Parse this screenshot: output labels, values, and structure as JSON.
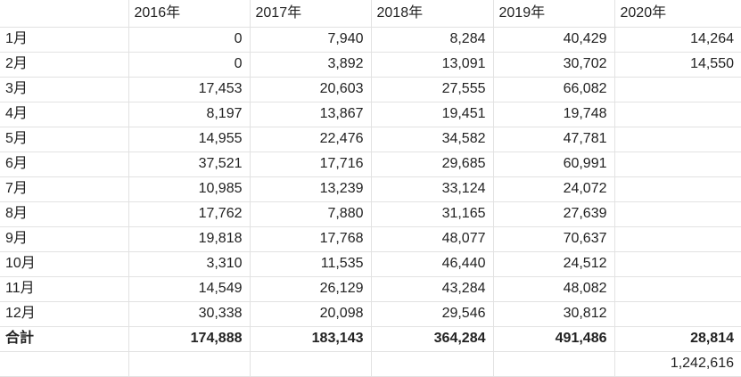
{
  "sheet": {
    "headers": [
      "",
      "2016年",
      "2017年",
      "2018年",
      "2019年",
      "2020年"
    ],
    "rows": [
      {
        "label": "1月",
        "values": [
          "0",
          "7,940",
          "8,284",
          "40,429",
          "14,264"
        ]
      },
      {
        "label": "2月",
        "values": [
          "0",
          "3,892",
          "13,091",
          "30,702",
          "14,550"
        ]
      },
      {
        "label": "3月",
        "values": [
          "17,453",
          "20,603",
          "27,555",
          "66,082",
          ""
        ]
      },
      {
        "label": "4月",
        "values": [
          "8,197",
          "13,867",
          "19,451",
          "19,748",
          ""
        ]
      },
      {
        "label": "5月",
        "values": [
          "14,955",
          "22,476",
          "34,582",
          "47,781",
          ""
        ]
      },
      {
        "label": "6月",
        "values": [
          "37,521",
          "17,716",
          "29,685",
          "60,991",
          ""
        ]
      },
      {
        "label": "7月",
        "values": [
          "10,985",
          "13,239",
          "33,124",
          "24,072",
          ""
        ]
      },
      {
        "label": "8月",
        "values": [
          "17,762",
          "7,880",
          "31,165",
          "27,639",
          ""
        ]
      },
      {
        "label": "9月",
        "values": [
          "19,818",
          "17,768",
          "48,077",
          "70,637",
          ""
        ]
      },
      {
        "label": "10月",
        "values": [
          "3,310",
          "11,535",
          "46,440",
          "24,512",
          ""
        ]
      },
      {
        "label": "11月",
        "values": [
          "14,549",
          "26,129",
          "43,284",
          "48,082",
          ""
        ]
      },
      {
        "label": "12月",
        "values": [
          "30,338",
          "20,098",
          "29,546",
          "30,812",
          ""
        ]
      }
    ],
    "total": {
      "label": "合計",
      "values": [
        "174,888",
        "183,143",
        "364,284",
        "491,486",
        "28,814"
      ]
    },
    "grand_total": {
      "label": "",
      "values": [
        "",
        "",
        "",
        "",
        "1,242,616"
      ]
    }
  }
}
